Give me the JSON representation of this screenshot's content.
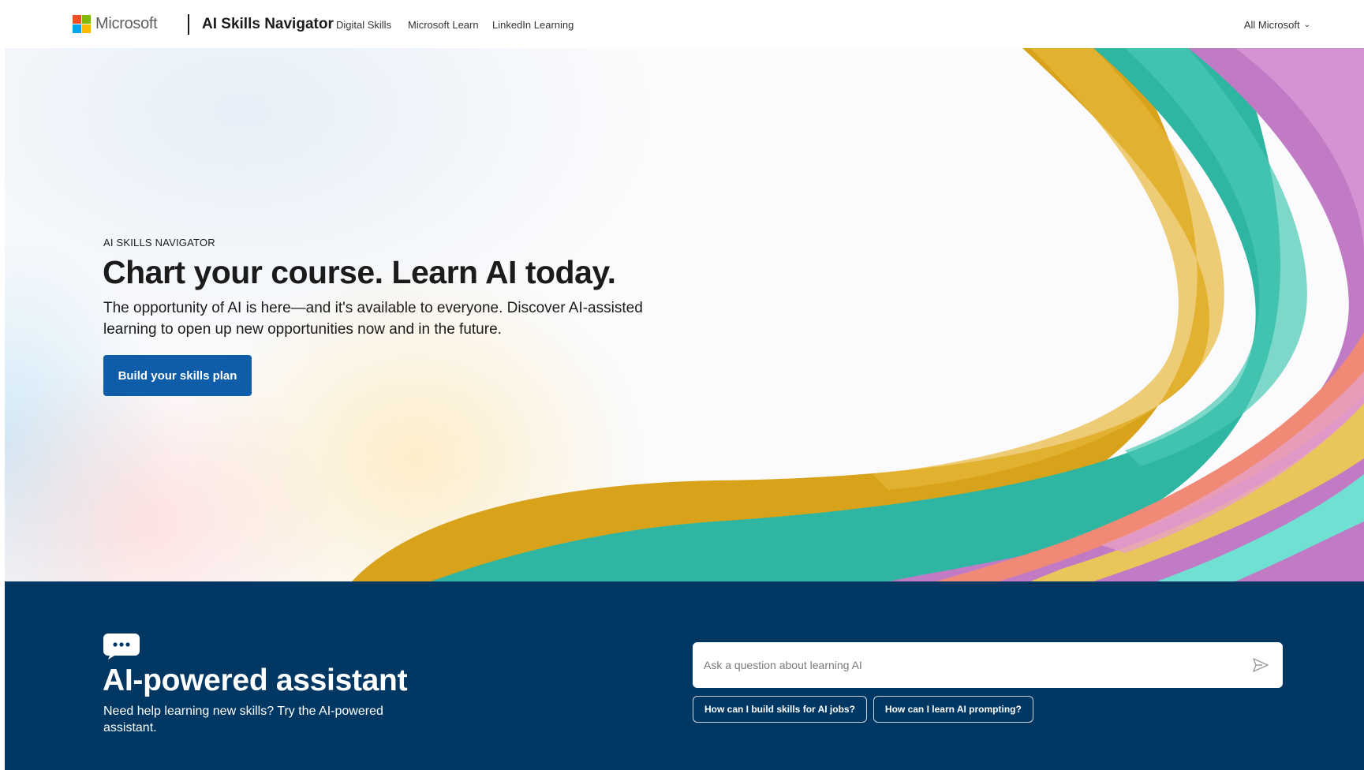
{
  "header": {
    "brand": "Microsoft",
    "site_title": "AI Skills Navigator",
    "nav": [
      "Digital Skills",
      "Microsoft Learn",
      "LinkedIn Learning"
    ],
    "all_microsoft": "All Microsoft",
    "logo_colors": [
      "#f25022",
      "#7fba00",
      "#00a4ef",
      "#ffb900"
    ]
  },
  "hero": {
    "eyebrow": "AI SKILLS NAVIGATOR",
    "title": "Chart your course. Learn AI today.",
    "description": "The opportunity of AI is here—and it's available to everyone. Discover AI-assisted learning to open up new opportunities now and in the future.",
    "cta_label": "Build your skills plan",
    "cta_color": "#0f5ca8"
  },
  "assistant": {
    "icon": "chat-bubble-icon",
    "title": "AI-powered assistant",
    "description": "Need help learning new skills? Try the AI-powered assistant.",
    "input_placeholder": "Ask a question about learning AI",
    "send_icon": "send-icon",
    "suggestions": [
      "How can I build skills for AI jobs?",
      "How can I learn AI prompting?"
    ],
    "background_color": "#003863"
  }
}
